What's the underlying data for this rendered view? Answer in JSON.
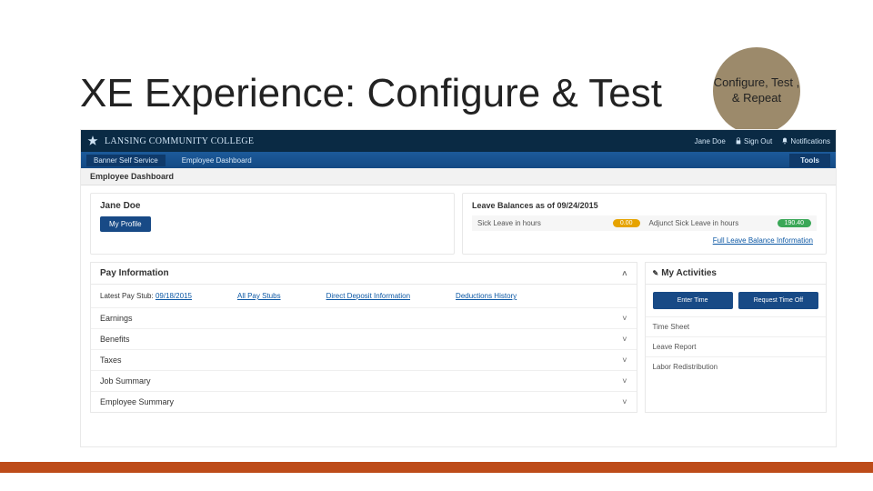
{
  "slide": {
    "title": "XE Experience: Configure & Test",
    "badge_text": "Configure, Test , & Repeat"
  },
  "header": {
    "institution": "LANSING COMMUNITY COLLEGE",
    "user": "Jane Doe",
    "sign_out": "Sign Out",
    "notifications": "Notifications"
  },
  "nav": {
    "item1": "Banner Self Service",
    "item2": "Employee Dashboard",
    "tools": "Tools"
  },
  "breadcrumb": "Employee Dashboard",
  "profile": {
    "name": "Jane Doe",
    "button": "My Profile"
  },
  "leave": {
    "title": "Leave Balances as of 09/24/2015",
    "item1_label": "Sick Leave in hours",
    "item1_value": "0.00",
    "item2_label": "Adjunct Sick Leave in hours",
    "item2_value": "190.40",
    "full_link": "Full Leave Balance Information"
  },
  "pay": {
    "title": "Pay Information",
    "latest_label": "Latest Pay Stub:",
    "latest_link": "09/18/2015",
    "all_stubs": "All Pay Stubs",
    "direct_deposit": "Direct Deposit Information",
    "deductions": "Deductions History",
    "sections": {
      "earnings": "Earnings",
      "benefits": "Benefits",
      "taxes": "Taxes",
      "job_summary": "Job Summary",
      "employee_summary": "Employee Summary"
    }
  },
  "activities": {
    "title": "My Activities",
    "btn1": "Enter Time",
    "btn2": "Request Time Off",
    "item1": "Time Sheet",
    "item2": "Leave Report",
    "item3": "Labor Redistribution"
  }
}
